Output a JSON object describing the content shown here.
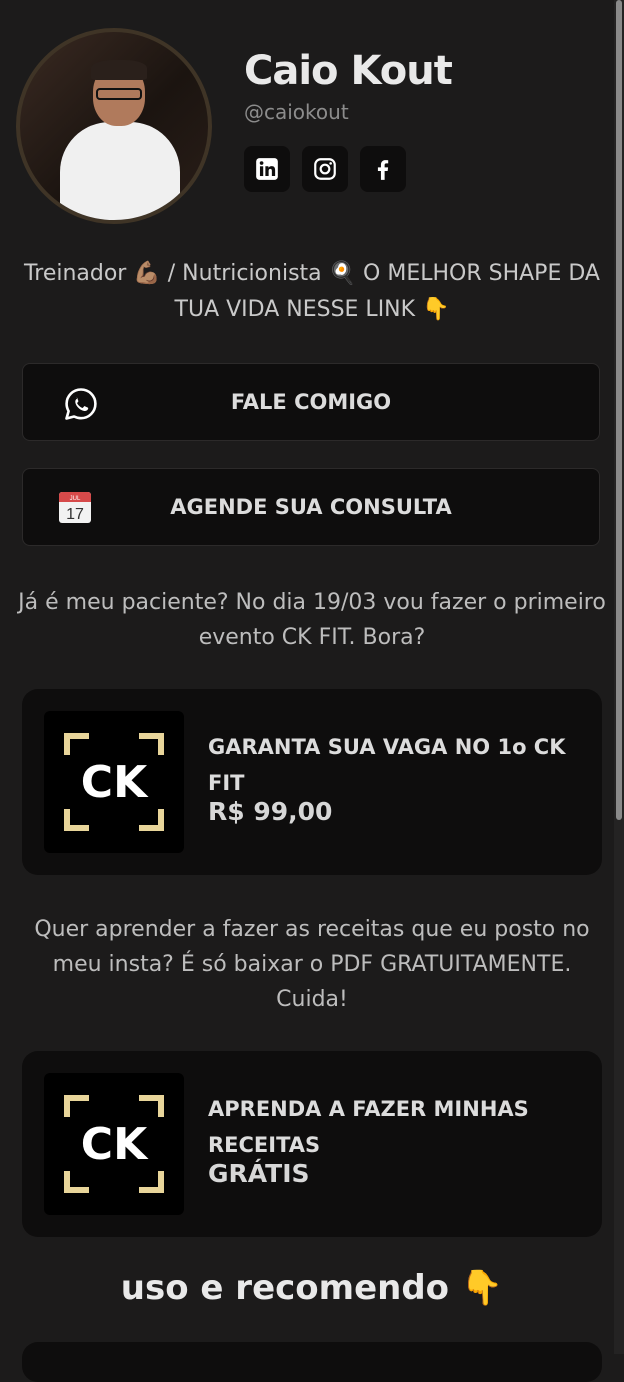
{
  "profile": {
    "name": "Caio Kout",
    "handle": "@caiokout",
    "avatar_alt": "Caio Kout profile photo",
    "socials": [
      {
        "icon": "linkedin-icon"
      },
      {
        "icon": "instagram-icon"
      },
      {
        "icon": "facebook-icon"
      }
    ]
  },
  "bio": {
    "part1": "Treinador ",
    "part2": " / Nutricionista ",
    "part3": " O MELHOR SHAPE DA TUA VIDA NESSE LINK ",
    "emoji1": "💪🏽",
    "emoji2": "🍳",
    "emoji3": "👇"
  },
  "links": [
    {
      "label": "FALE COMIGO",
      "icon": "whatsapp-icon"
    },
    {
      "label": "AGENDE SUA CONSULTA",
      "icon": "calendar-icon",
      "calendar_day": "17",
      "calendar_month": "JUL"
    }
  ],
  "notes": {
    "event": "Já é meu paciente? No dia 19/03 vou fazer o primeiro evento CK FIT. Bora?",
    "recipes": "Quer aprender a fazer as receitas que eu posto no meu insta? É só baixar o PDF GRATUITAMENTE. Cuida!"
  },
  "products": [
    {
      "title": "GARANTA SUA VAGA NO 1o CK FIT",
      "price": "R$ 99,00",
      "logo_text": "CK"
    },
    {
      "title": "APRENDA A FAZER MINHAS RECEITAS",
      "price": "GRÁTIS",
      "logo_text": "CK"
    }
  ],
  "section": {
    "heading": "uso e recomendo ",
    "emoji": "👇"
  },
  "colors": {
    "background": "#1c1b1b",
    "card": "#0e0d0d",
    "logo_gold": "#e8d59a"
  }
}
